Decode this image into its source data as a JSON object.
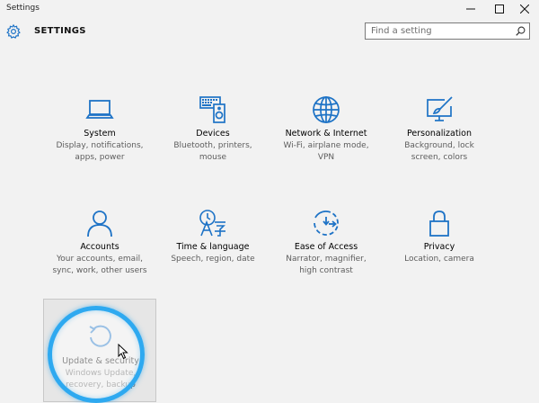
{
  "window": {
    "title": "Settings"
  },
  "header": {
    "title": "SETTINGS",
    "icon": "gear-icon"
  },
  "search": {
    "placeholder": "Find a setting",
    "value": "",
    "icon": "search-icon"
  },
  "tiles": [
    {
      "name": "System",
      "desc": "Display, notifications,\napps, power",
      "icon": "laptop-icon"
    },
    {
      "name": "Devices",
      "desc": "Bluetooth, printers,\nmouse",
      "icon": "keyboard-speaker-icon"
    },
    {
      "name": "Network & Internet",
      "desc": "Wi-Fi, airplane mode,\nVPN",
      "icon": "globe-icon"
    },
    {
      "name": "Personalization",
      "desc": "Background, lock\nscreen, colors",
      "icon": "paint-monitor-icon"
    },
    {
      "name": "Accounts",
      "desc": "Your accounts, email,\nsync, work, other users",
      "icon": "person-icon"
    },
    {
      "name": "Time & language",
      "desc": "Speech, region, date",
      "icon": "time-language-icon"
    },
    {
      "name": "Ease of Access",
      "desc": "Narrator, magnifier,\nhigh contrast",
      "icon": "ease-of-access-icon"
    },
    {
      "name": "Privacy",
      "desc": "Location, camera",
      "icon": "lock-icon"
    },
    {
      "name": "Update & security",
      "desc": "Windows Update,\nrecovery, backup",
      "icon": "refresh-icon"
    }
  ],
  "colors": {
    "accent": "#1e73c6",
    "highlight_ring": "#2ea9f0",
    "background": "#f2f2f2"
  }
}
